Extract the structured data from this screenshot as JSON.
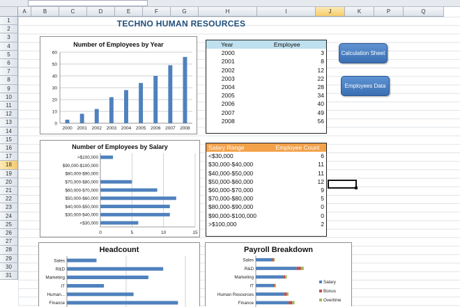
{
  "sheet": {
    "columns": [
      "A",
      "B",
      "C",
      "D",
      "E",
      "F",
      "G",
      "H",
      "I",
      "J",
      "K",
      "P",
      "Q"
    ],
    "rows": [
      1,
      2,
      3,
      4,
      5,
      6,
      7,
      8,
      9,
      10,
      11,
      12,
      13,
      14,
      15,
      16,
      17,
      18,
      19,
      20,
      21,
      22,
      23,
      24,
      25,
      26,
      27,
      28,
      29,
      30,
      31
    ],
    "selected_column": "J",
    "selected_row": 18,
    "title": "TECHNO HUMAN RESOURCES"
  },
  "year_table": {
    "headers": [
      "Year",
      "Employee"
    ],
    "header_color": "#bfe0ee",
    "rows": [
      [
        "2000",
        "3"
      ],
      [
        "2001",
        "8"
      ],
      [
        "2002",
        "12"
      ],
      [
        "2003",
        "22"
      ],
      [
        "2004",
        "28"
      ],
      [
        "2005",
        "34"
      ],
      [
        "2006",
        "40"
      ],
      [
        "2007",
        "49"
      ],
      [
        "2008",
        "56"
      ]
    ]
  },
  "salary_table": {
    "headers": [
      "Salary Range",
      "Employee Count"
    ],
    "header_color": "#f4a24a",
    "rows": [
      [
        "<$30,000",
        "6"
      ],
      [
        "$30,000-$40,000",
        "11"
      ],
      [
        "$40,000-$50,000",
        "11"
      ],
      [
        "$50,000-$60,000",
        "12"
      ],
      [
        "$60,000-$70,000",
        "9"
      ],
      [
        "$70,000-$80,000",
        "5"
      ],
      [
        "$80,000-$90,000",
        "0"
      ],
      [
        "$90,000-$100,000",
        "0"
      ],
      [
        ">$100,000",
        "2"
      ]
    ]
  },
  "buttons": {
    "calculation_sheet": "Calculation Sheet",
    "employees_data": "Employees Data"
  },
  "chart_data": [
    {
      "type": "bar",
      "title": "Number of Employees by Year",
      "categories": [
        "2000",
        "2001",
        "2002",
        "2003",
        "2004",
        "2005",
        "2006",
        "2007",
        "2008"
      ],
      "values": [
        3,
        8,
        12,
        22,
        28,
        34,
        40,
        49,
        56
      ],
      "ylim": [
        0,
        60
      ],
      "yticks": [
        0,
        10,
        20,
        30,
        40,
        50,
        60
      ],
      "color": "#4f81bd",
      "grid": true
    },
    {
      "type": "bar",
      "orientation": "horizontal",
      "title": "Number of Employees by Salary",
      "categories": [
        ">$100,000",
        "$90,000-$100,000",
        "$80,000-$90,000",
        "$70,000-$80,000",
        "$60,000-$70,000",
        "$50,000-$60,000",
        "$40,000-$50,000",
        "$30,000-$40,000",
        "<$30,000"
      ],
      "values": [
        2,
        0,
        0,
        5,
        9,
        12,
        11,
        11,
        6
      ],
      "xlim": [
        0,
        15
      ],
      "xticks": [
        0,
        5,
        10,
        15
      ],
      "color": "#4f81bd",
      "grid": true
    },
    {
      "type": "bar",
      "orientation": "horizontal",
      "title": "Headcount",
      "categories": [
        "Sales",
        "R&D",
        "Marketing",
        "IT",
        "Human...",
        "Finance"
      ],
      "values": [
        4,
        13,
        11,
        5,
        9,
        15
      ],
      "xlim": [
        0,
        16
      ],
      "color": "#4f81bd",
      "grid": true
    },
    {
      "type": "bar",
      "orientation": "horizontal",
      "stacked": true,
      "title": "Payroll Breakdown",
      "categories": [
        "Sales",
        "R&D",
        "Marketing",
        "IT",
        "Human Resources",
        "Finance"
      ],
      "series": [
        {
          "name": "Salary",
          "values": [
            30,
            75,
            50,
            32,
            52,
            60
          ],
          "color": "#4f81bd"
        },
        {
          "name": "Bonus",
          "values": [
            3,
            8,
            4,
            3,
            5,
            7
          ],
          "color": "#c0504d"
        },
        {
          "name": "Overtime",
          "values": [
            2,
            5,
            3,
            2,
            3,
            4
          ],
          "color": "#9bbb59"
        }
      ],
      "legend": "right"
    }
  ]
}
